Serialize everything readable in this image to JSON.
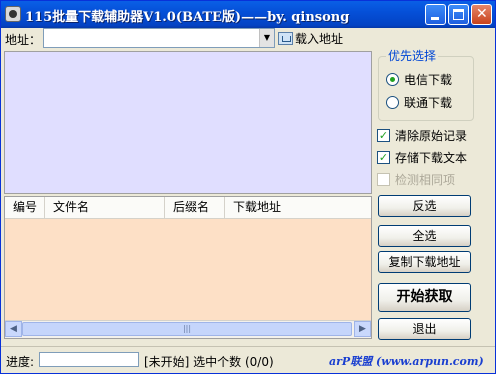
{
  "window": {
    "title": "115批量下载辅助器V1.0(BATE版)——by. qinsong",
    "buttons": {
      "minimize": "minimize-icon",
      "maximize": "maximize-icon",
      "close": "close-icon"
    }
  },
  "address": {
    "label": "地址：",
    "value": "",
    "load_label": "载入地址"
  },
  "list": {
    "columns": [
      "编号",
      "文件名",
      "后缀名",
      "下载地址"
    ]
  },
  "options": {
    "group_title": "优先选择",
    "radios": [
      {
        "label": "电信下载",
        "selected": true
      },
      {
        "label": "联通下载",
        "selected": false
      }
    ],
    "checks": [
      {
        "label": "清除原始记录",
        "checked": true,
        "enabled": true
      },
      {
        "label": "存储下载文本",
        "checked": true,
        "enabled": true
      },
      {
        "label": "检测相同项",
        "checked": false,
        "enabled": false
      }
    ]
  },
  "actions": {
    "invert": "反选",
    "select_all": "全选",
    "copy": "复制下载地址",
    "start": "开始获取",
    "exit": "退出"
  },
  "status": {
    "progress_label": "进度:",
    "text": "[未开始] 选中个数 (0/0)",
    "brand": "arP联盟 (www.arpun.com)"
  },
  "colors": {
    "title_bar": "#0550d8",
    "log_bg": "#e0deff",
    "list_bg": "#fde0c6"
  }
}
